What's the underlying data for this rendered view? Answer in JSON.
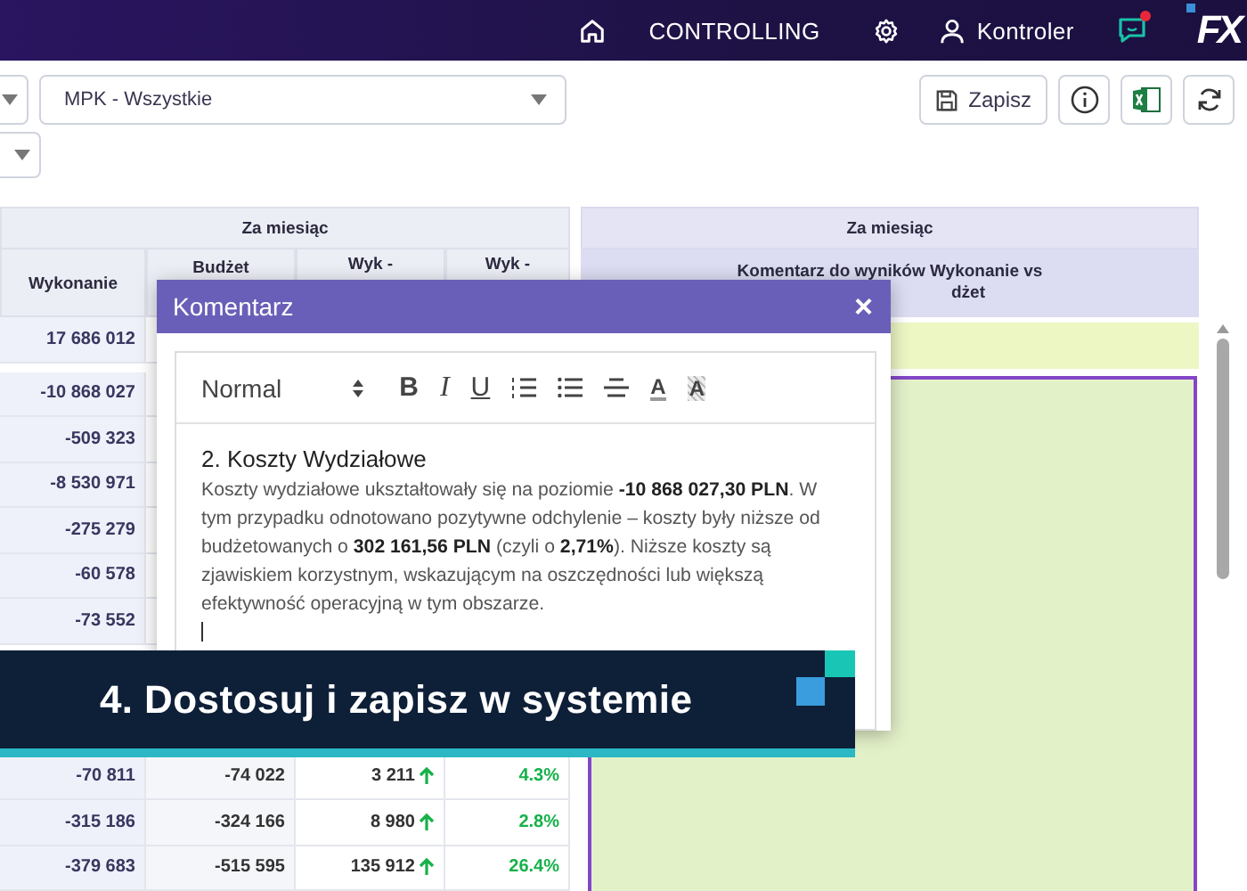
{
  "topbar": {
    "items": [
      {
        "kind": "home"
      },
      {
        "kind": "label",
        "text": "CONTROLLING"
      },
      {
        "kind": "settings"
      },
      {
        "kind": "user",
        "text": "Kontroler"
      },
      {
        "kind": "chat",
        "notification": true
      },
      {
        "kind": "logo",
        "text": "FX"
      }
    ]
  },
  "filters": {
    "value": "MPK - Wszystkie"
  },
  "actions": [
    {
      "kind": "save",
      "label": "Zapisz"
    },
    {
      "kind": "info"
    },
    {
      "kind": "excel"
    },
    {
      "kind": "refresh"
    }
  ],
  "table": {
    "group_header": "Za miesiąc",
    "columns": [
      "Wykonanie",
      "Budżet",
      "Wyk -",
      "Wyk -"
    ],
    "sections": [
      {
        "rows": [
          {
            "cells": [
              "17 686 012"
            ]
          }
        ]
      },
      {
        "rows": [
          {
            "cells": [
              "-10 868 027"
            ]
          },
          {
            "cells": [
              "-509 323"
            ]
          },
          {
            "cells": [
              "-8 530 971"
            ]
          },
          {
            "cells": [
              "-275 279"
            ]
          },
          {
            "cells": [
              "-60 578"
            ]
          },
          {
            "cells": [
              "-73 552"
            ]
          }
        ]
      },
      {
        "rows": [
          {
            "cells": [
              "-70 811",
              "-74 022",
              "3 211",
              "4.3%"
            ],
            "increase": true
          },
          {
            "cells": [
              "-315 186",
              "-324 166",
              "8 980",
              "2.8%"
            ],
            "increase": true
          },
          {
            "cells": [
              "-379 683",
              "-515 595",
              "135 912",
              "26.4%"
            ],
            "increase": true
          }
        ]
      }
    ]
  },
  "comments_panel": {
    "group_header": "Za miesiąc",
    "column_header": [
      "Komentarz do wyników Wykonanie vs",
      "dżet"
    ]
  },
  "dialog": {
    "title": "Komentarz",
    "close": "×",
    "format": "Normal",
    "tools": [
      {
        "kind": "bold",
        "label": "B"
      },
      {
        "kind": "italic",
        "label": "I"
      },
      {
        "kind": "underline",
        "label": "U"
      },
      {
        "kind": "ordered-list"
      },
      {
        "kind": "bullet-list"
      },
      {
        "kind": "align"
      },
      {
        "kind": "color",
        "label": "A"
      },
      {
        "kind": "background",
        "label": "A"
      }
    ],
    "heading": "2. Koszty Wydziałowe",
    "body": "Koszty wydziałowe ukształtowały się na poziomie **-10 868 027,30 PLN**. W tym przypadku odnotowano pozytywne odchylenie – koszty były niższe od budżetowanych o **302 161,56 PLN** (czyli o **2,71%**). Niższe koszty są zjawiskiem korzystnym, wskazującym na oszczędności lub większą efektywność operacyjną w tym obszarze."
  },
  "banner": {
    "text": "4. Dostosuj i zapisz w systemie"
  }
}
